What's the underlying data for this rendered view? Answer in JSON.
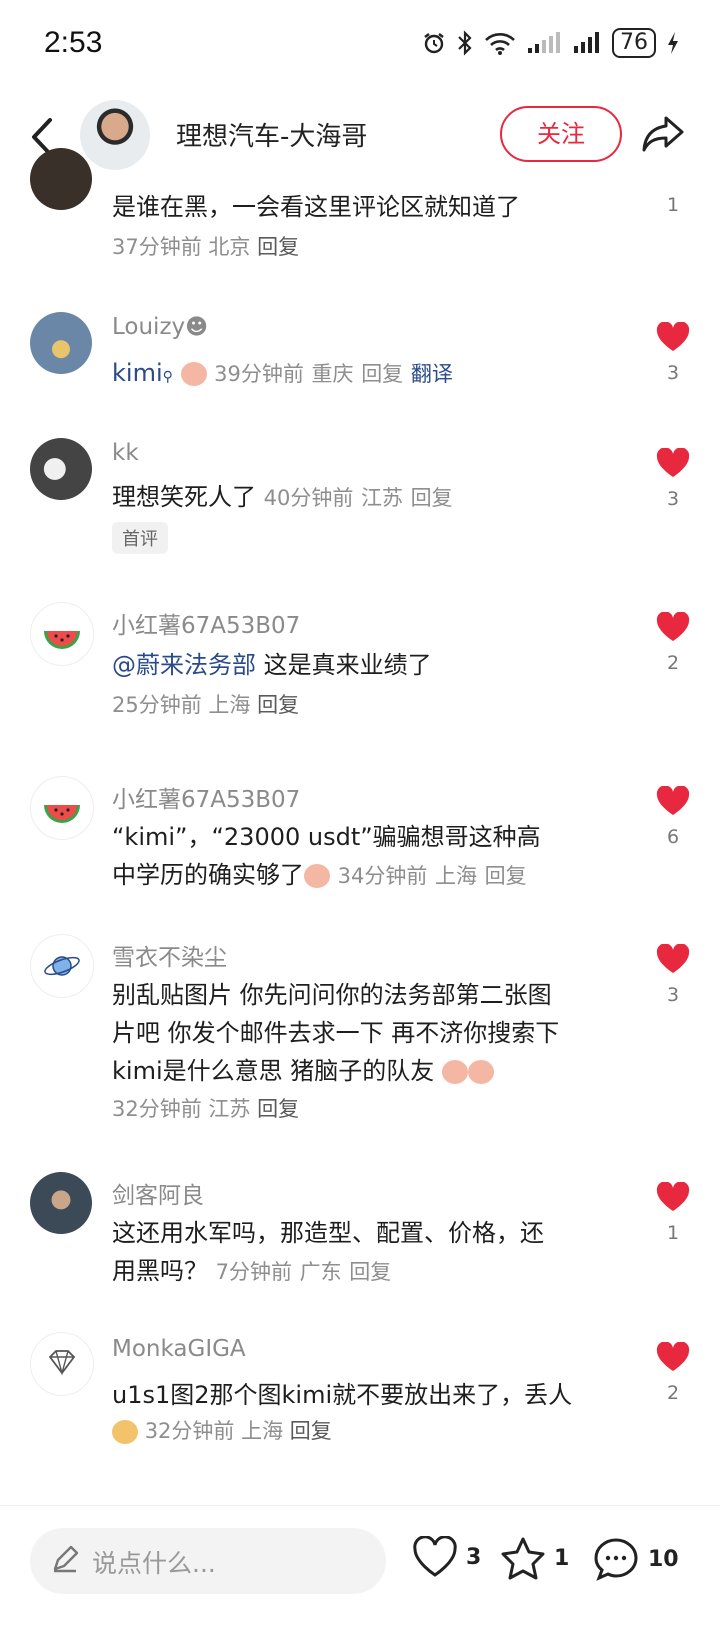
{
  "status": {
    "time": "2:53",
    "battery": "76",
    "icons": [
      "alarm-icon",
      "bluetooth-icon",
      "wifi-icon",
      "signal-icon",
      "signal-icon",
      "battery-icon",
      "charging-icon"
    ]
  },
  "header": {
    "title": "理想汽车-大海哥",
    "follow_label": "关注"
  },
  "comments": [
    {
      "name": "",
      "text": "是谁在黑，一会看这里评论区就知道了",
      "time": "37分钟前",
      "location": "北京",
      "reply": "回复",
      "likes": "1"
    },
    {
      "name": "Louizy",
      "text_prefix": "kimi",
      "time": "39分钟前",
      "location": "重庆",
      "reply": "回复",
      "translate": "翻译",
      "likes": "3"
    },
    {
      "name": "kk",
      "text": "理想笑死人了",
      "time": "40分钟前",
      "location": "江苏",
      "reply": "回复",
      "tag": "首评",
      "likes": "3"
    },
    {
      "name": "小红薯67A53B07",
      "mention": "@蔚来法务部",
      "text": "这是真来业绩了",
      "time": "25分钟前",
      "location": "上海",
      "reply": "回复",
      "likes": "2"
    },
    {
      "name": "小红薯67A53B07",
      "text_line1": "“kimi”，“23000 usdt”骗骗想哥这种高",
      "text_line2": "中学历的确实够了",
      "time": "34分钟前",
      "location": "上海",
      "reply": "回复",
      "likes": "6"
    },
    {
      "name": "雪衣不染尘",
      "text_line1": "别乱贴图片 你先问问你的法务部第二张图",
      "text_line2": "片吧 你发个邮件去求一下 再不济你搜索下",
      "text_line3": "kimi是什么意思 猪脑子的队友",
      "time": "32分钟前",
      "location": "江苏",
      "reply": "回复",
      "likes": "3"
    },
    {
      "name": "剑客阿良",
      "text_line1": "这还用水军吗，那造型、配置、价格，还",
      "text_line2": "用黑吗？",
      "time": "7分钟前",
      "location": "广东",
      "reply": "回复",
      "likes": "1"
    },
    {
      "name": "MonkaGIGA",
      "text": "u1s1图2那个图kimi就不要放出来了，丢人",
      "time": "32分钟前",
      "location": "上海",
      "reply": "回复",
      "likes": "2"
    }
  ],
  "bottom": {
    "placeholder": "说点什么...",
    "likes": "3",
    "stars": "1",
    "comments": "10"
  },
  "colors": {
    "accent": "#e8283f",
    "link": "#2a4a8a"
  }
}
